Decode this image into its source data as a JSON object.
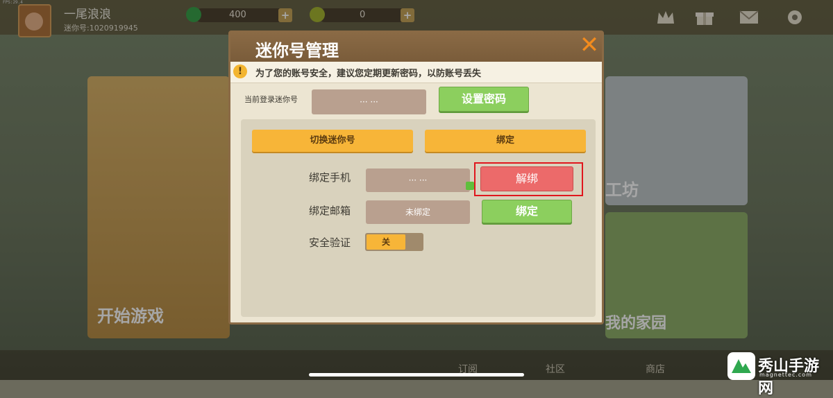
{
  "fps": "FPS:29.4",
  "user": {
    "name": "一尾浪浪",
    "id_label": "迷你号:1020919945"
  },
  "currency": {
    "gems": "400",
    "coins": "0",
    "plus": "+"
  },
  "side": {
    "left_card": "开始游戏",
    "right_card_1": "工坊",
    "right_card_2": "我的家园"
  },
  "bottom": {
    "item1": "订阅",
    "item2": "社区",
    "item3": "商店"
  },
  "watermark": {
    "title": "秀山手游网",
    "sub": "magnettec.com"
  },
  "dialog": {
    "title": "迷你号管理",
    "close": "✕",
    "warning": "为了您的账号安全，建议您定期更新密码，以防账号丢失",
    "warning_icon": "!",
    "current_label": "当前登录迷你号",
    "current_value": "··· ···",
    "set_password": "设置密码",
    "tabs": [
      "切换迷你号",
      "绑定"
    ],
    "phone_label": "绑定手机",
    "phone_value": "··· ···",
    "unbind": "解绑",
    "email_label": "绑定邮箱",
    "email_value": "未绑定",
    "bind": "绑定",
    "security_label": "安全验证",
    "security_toggle": "关"
  },
  "colors": {
    "accent_red": "#e0161d",
    "tab_yellow": "#f7b538",
    "green": "#8ccf5e"
  }
}
